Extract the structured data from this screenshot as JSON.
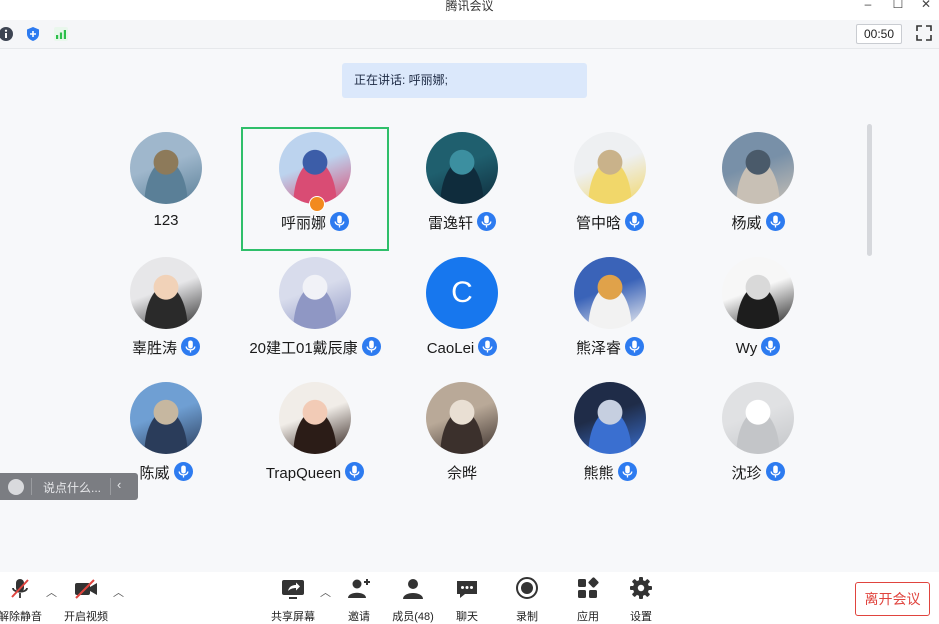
{
  "window": {
    "title": "腾讯会议"
  },
  "topbar": {
    "timer": "00:50"
  },
  "speaking": {
    "text": "正在讲话: 呼丽娜;"
  },
  "participants": [
    {
      "name": "123",
      "mic": false,
      "colors": [
        "#9fb7cc",
        "#5a7f97",
        "#8d7a5a"
      ]
    },
    {
      "name": "呼丽娜",
      "mic": true,
      "active": true,
      "host": true,
      "colors": [
        "#bcd3ee",
        "#d94c74",
        "#3c5da8"
      ]
    },
    {
      "name": "雷逸轩",
      "mic": true,
      "colors": [
        "#1f5f6e",
        "#0f2c3c",
        "#3c8fa0"
      ]
    },
    {
      "name": "管中晗",
      "mic": true,
      "colors": [
        "#eef0f2",
        "#f1d76a",
        "#c9b28a"
      ]
    },
    {
      "name": "杨威",
      "mic": true,
      "colors": [
        "#7890a8",
        "#c8c0b5",
        "#4a5a6a"
      ]
    },
    {
      "name": "辜胜涛",
      "mic": true,
      "colors": [
        "#e7e7e9",
        "#2a2a2a",
        "#f1d2b8"
      ]
    },
    {
      "name": "20建工01戴辰康",
      "mic": true,
      "colors": [
        "#d8dcec",
        "#8f97c4",
        "#f1f2f7"
      ]
    },
    {
      "name": "CaoLei",
      "mic": true,
      "colors": [
        "#1777ee",
        "#1777ee",
        "#1777ee"
      ],
      "letter": "C"
    },
    {
      "name": "熊泽睿",
      "mic": true,
      "colors": [
        "#3a63b8",
        "#f2f2f2",
        "#e0a24a"
      ]
    },
    {
      "name": "Wy",
      "mic": true,
      "colors": [
        "#f7f7f7",
        "#1d1d1d",
        "#d9d9d9"
      ]
    },
    {
      "name": "陈威",
      "mic": true,
      "colors": [
        "#6f9fd3",
        "#2a3c5a",
        "#c6b7a0"
      ]
    },
    {
      "name": "TrapQueen",
      "mic": true,
      "colors": [
        "#f1ede8",
        "#2b1c17",
        "#f2cbb6"
      ]
    },
    {
      "name": "佘晔",
      "mic": false,
      "colors": [
        "#b9a998",
        "#3b302c",
        "#e9dfd3"
      ]
    },
    {
      "name": "熊熊",
      "mic": true,
      "colors": [
        "#1f2c48",
        "#3a6fd0",
        "#c6cfe0"
      ]
    },
    {
      "name": "沈珍",
      "mic": true,
      "colors": [
        "#e0e1e3",
        "#c3c5c8",
        "#ffffff"
      ]
    }
  ],
  "chat": {
    "placeholder": "说点什么..."
  },
  "bottombar": {
    "unmute": "解除静音",
    "video": "开启视频",
    "share": "共享屏幕",
    "invite": "邀请",
    "members": "成员(48)",
    "chat": "聊天",
    "record": "录制",
    "apps": "应用",
    "settings": "设置",
    "leave": "离开会议"
  },
  "colors": {
    "accent": "#2d7bf0",
    "active_border": "#2fbf6a",
    "leave": "#e0443e",
    "signal": "#2bbf4a"
  }
}
